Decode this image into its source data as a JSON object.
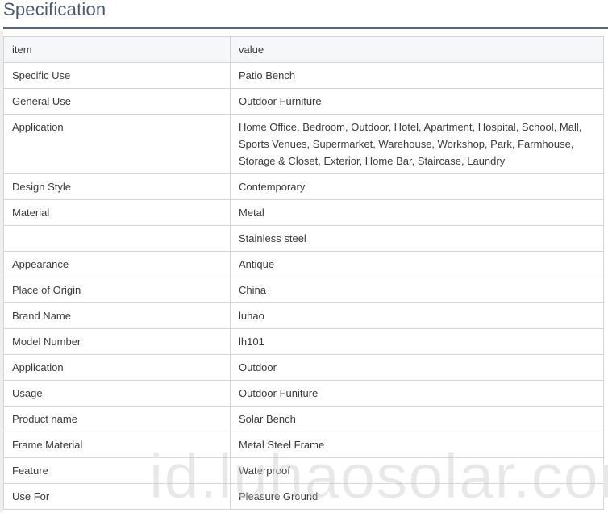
{
  "title": "Specification",
  "table": {
    "header": {
      "item": "item",
      "value": "value"
    },
    "rows": [
      {
        "item": "Specific Use",
        "value": "Patio Bench"
      },
      {
        "item": "General Use",
        "value": "Outdoor Furniture"
      },
      {
        "item": "Application",
        "value": "Home Office, Bedroom, Outdoor, Hotel, Apartment, Hospital, School, Mall, Sports Venues, Supermarket, Warehouse, Workshop, Park, Farmhouse, Storage & Closet, Exterior, Home Bar, Staircase, Laundry"
      },
      {
        "item": "Design Style",
        "value": "Contemporary"
      },
      {
        "item": "Material",
        "value": "Metal"
      },
      {
        "item": "",
        "value": "Stainless steel"
      },
      {
        "item": "Appearance",
        "value": "Antique"
      },
      {
        "item": "Place of Origin",
        "value": "China"
      },
      {
        "item": "Brand Name",
        "value": "luhao"
      },
      {
        "item": "Model Number",
        "value": "lh101"
      },
      {
        "item": "Application",
        "value": "Outdoor"
      },
      {
        "item": "Usage",
        "value": "Outdoor Funiture"
      },
      {
        "item": "Product name",
        "value": "Solar Bench"
      },
      {
        "item": "Frame Material",
        "value": "Metal Steel Frame"
      },
      {
        "item": "Feature",
        "value": "Waterproof"
      },
      {
        "item": "Use For",
        "value": "Pleasure Ground"
      }
    ]
  },
  "watermark": "id.luhaosolar.com"
}
